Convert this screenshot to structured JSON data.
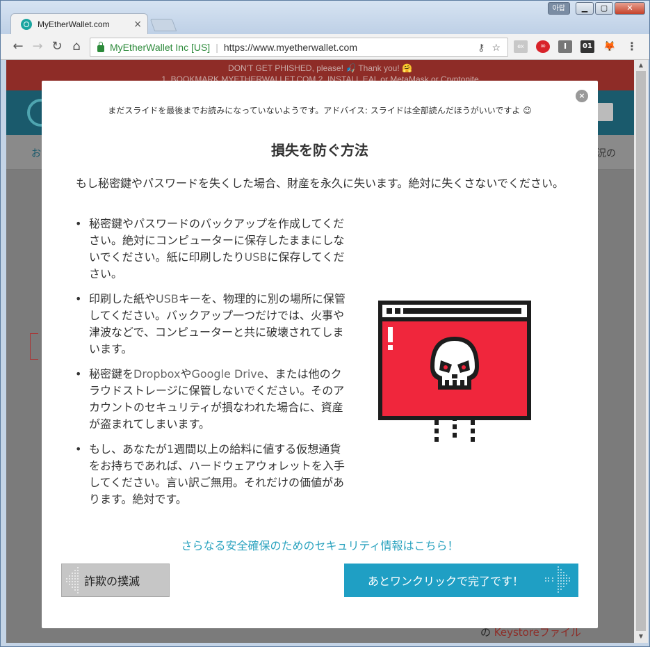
{
  "window": {
    "lang_badge": "아랍",
    "minimize": "▁",
    "maximize": "▢",
    "close": "✕"
  },
  "tab": {
    "title": "MyEtherWallet.com",
    "close": "×"
  },
  "toolbar": {
    "back": "←",
    "forward": "→",
    "reload": "↻",
    "home": "⌂",
    "ev_name": "MyEtherWallet Inc [US]",
    "url": "https://www.myetherwallet.com",
    "key_icon": "⚷",
    "star_icon": "☆",
    "extensions": [
      "ex",
      "∞",
      "I",
      "01",
      "🦊",
      "⋮"
    ]
  },
  "background": {
    "warning_line1": "DON'T GET PHISHED, please! 🎣 Thank you! 🤗",
    "warning_line2": "1. BOOKMARK MYETHERWALLET.COM        2. INSTALL EAL or MetaMask or Cryptonite",
    "nav_left": "お",
    "nav_right": "況の",
    "keystore_prefix": "の ",
    "keystore_word": "Keystore",
    "keystore_suffix": "ファイル"
  },
  "modal": {
    "close": "×",
    "advice": "まだスライドを最後までお読みになっていないようです。アドバイス: スライドは全部読んだほうがいいですよ ☺",
    "title": "損失を防ぐ方法",
    "intro": "もし秘密鍵やパスワードを失くした場合、財産を永久に失います。絶対に失くさないでください。",
    "bullets": [
      {
        "a": "秘密鍵やパスワードのバックアップを作成してください。絶対にコンピューターに保存したままにしないでください。紙に印刷したり",
        "b": "USB",
        "c": "に保存してください。"
      },
      {
        "a": "印刷した紙や",
        "b": "USB",
        "c": "キーを、物理的に別の場所に保管してください。バックアップ一つだけでは、火事や津波などで、コンピューターと共に破壊されてしまいます。"
      },
      {
        "a": "秘密鍵を",
        "b": "Dropbox",
        "c": "や",
        "d": "Google Drive",
        "e": "、または他のクラウドストレージに保管しないでください。そのアカウントのセキュリティが損なわれた場合に、資産が盗まれてしまいます。"
      },
      {
        "a": "もし、あなたが",
        "b": "1",
        "c": "週間以上の給料に値する仮想通貨をお持ちであれば、ハードウェアウォレットを入手してください。言い訳ご無用。それだけの価値があります。絶対です。"
      }
    ],
    "more_link": "さらなる安全確保のためのセキュリティ情報はこちら！",
    "btn_left": "詐欺の撲滅",
    "btn_right": "あとワンクリックで完了です！"
  },
  "colors": {
    "modal_accent": "#1f9fc4",
    "danger_red": "#f0263c",
    "warning_bar": "#8e2c27"
  }
}
